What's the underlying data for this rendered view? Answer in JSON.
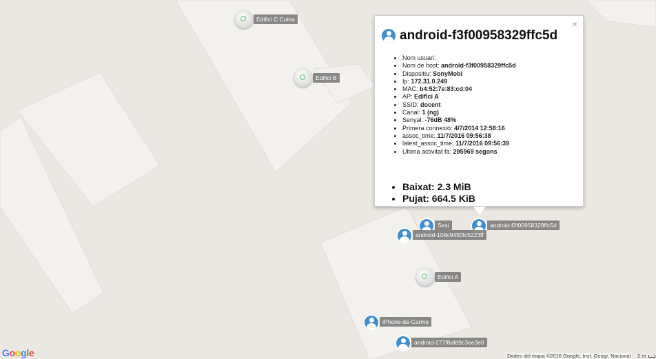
{
  "map": {
    "access_points": [
      {
        "name": "Edifici C Cuina"
      },
      {
        "name": "Edifici B"
      },
      {
        "name": "Edifici A"
      }
    ],
    "clients": [
      {
        "name": "Sesi"
      },
      {
        "name": "android-f3f00958329ffc5d"
      },
      {
        "name": "android-108c945f3c5223ff"
      },
      {
        "name": "iPhone-de-Carme"
      },
      {
        "name": "android-277f8afd9c3ee3e0"
      }
    ]
  },
  "popup": {
    "title": "android-f3f00958329ffc5d",
    "close": "×",
    "details": [
      {
        "label": "Nom usuari:",
        "value": ""
      },
      {
        "label": "Nom de host:",
        "value": "android-f3f00958329ffc5d"
      },
      {
        "label": "Dispositiu:",
        "value": "SonyMobi"
      },
      {
        "label": "Ip:",
        "value": "172.31.0.249"
      },
      {
        "label": "MAC:",
        "value": "b4:52:7e:83:cd:04"
      },
      {
        "label": "AP:",
        "value": "Edifici A"
      },
      {
        "label": "SSID:",
        "value": "docent"
      },
      {
        "label": "Canal:",
        "value": "1 (ng)"
      },
      {
        "label": "Senyal:",
        "value": "-76dB 48%"
      },
      {
        "label": "Primera connexió:",
        "value": "4/7/2014 12:58:16"
      },
      {
        "label": "assoc_time:",
        "value": "11/7/2016 09:56:38"
      },
      {
        "label": "latest_assoc_time:",
        "value": "11/7/2016 09:56:39"
      },
      {
        "label": "Ultima activitat fa:",
        "value": "295969 segons"
      }
    ],
    "traffic": [
      {
        "label": "Baixat:",
        "value": "2.3 MiB"
      },
      {
        "label": "Pujat:",
        "value": "664.5 KiB"
      }
    ]
  },
  "footer": {
    "logo_letters": [
      "G",
      "o",
      "o",
      "g",
      "l",
      "e"
    ],
    "logo_colors": [
      "#4285f4",
      "#ea4335",
      "#fbbc05",
      "#4285f4",
      "#34a853",
      "#ea4335"
    ],
    "attribution": "Dades del mapa ©2016 Google, Inst. Geogr. Nacional",
    "scale": "2 m"
  },
  "colors": {
    "background": "#ebe8e3",
    "building": "#f3f1ed",
    "building_edge": "#e2dfd9",
    "client_icon": "#3f8fd0",
    "ap_ring": "#5bc26a"
  }
}
